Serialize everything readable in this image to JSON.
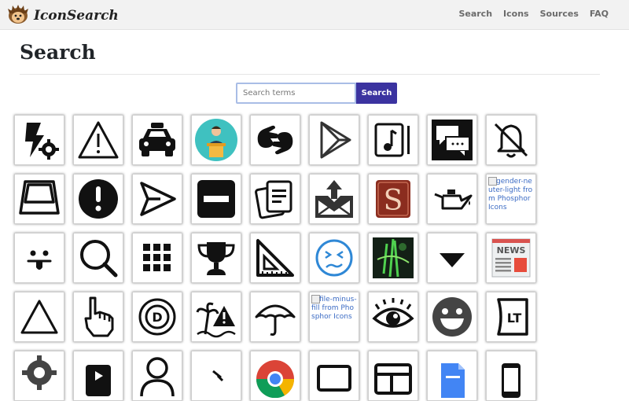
{
  "brand": {
    "name": "IconSearch"
  },
  "nav": {
    "items": [
      "Search",
      "Icons",
      "Sources",
      "FAQ"
    ]
  },
  "page": {
    "title": "Search"
  },
  "search": {
    "placeholder": "Search terms",
    "button_label": "Search"
  },
  "broken_images": {
    "gender": "gender-neuter-light from Phosphor Icons",
    "fileminus": "file-minus-fill from Phosphor Icons"
  },
  "icons": [
    [
      "lightning-gear-icon",
      "warning-triangle-icon",
      "taxi-icon",
      "speaker-podium-icon",
      "sign-language-icon",
      "play-store-icon",
      "music-file-icon",
      "chat-bubbles-icon",
      "bell-off-icon"
    ],
    [
      "keycap-icon",
      "exclamation-circle-icon",
      "paper-plane-icon",
      "minus-square-icon",
      "documents-icon",
      "mail-upload-icon",
      "letter-s-icon",
      "oil-can-icon",
      "broken-image-gender-neuter"
    ],
    [
      "tongue-face-icon",
      "magnifier-icon",
      "grid-dots-icon",
      "trophy-icon",
      "set-square-icon",
      "confused-face-icon",
      "green-abstract-icon",
      "caret-down-icon",
      "newspaper-icon"
    ],
    [
      "triangle-outline-icon",
      "pointing-hand-icon",
      "letter-d-circle-icon",
      "beach-warning-icon",
      "umbrella-icon",
      "broken-image-file-minus",
      "eye-icon",
      "grin-face-icon",
      "lt-badge-icon"
    ],
    [
      "gear-icon",
      "play-tablet-icon",
      "user-outline-icon",
      "arrow-icon",
      "chrome-icon",
      "monitor-icon",
      "layout-icon",
      "docs-icon",
      "phone-icon"
    ]
  ],
  "colors": {
    "search_button": "#3b33a0",
    "input_border": "#a9bde6",
    "navbar_bg": "#f2f2f2",
    "nav_text": "#6b6b6b"
  }
}
